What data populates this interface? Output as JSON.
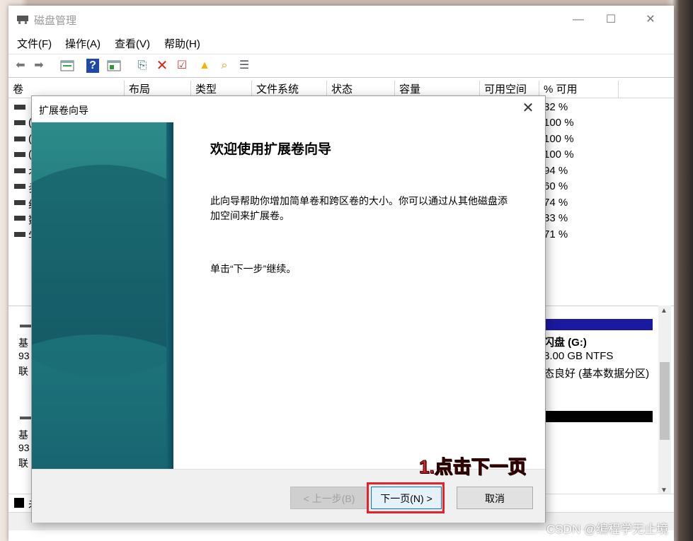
{
  "app": {
    "title": "磁盘管理"
  },
  "menu": [
    "文件(F)",
    "操作(A)",
    "查看(V)",
    "帮助(H)"
  ],
  "columns": [
    "卷",
    "布局",
    "类型",
    "文件系统",
    "状态",
    "容量",
    "可用空间",
    "% 可用"
  ],
  "rows": [
    {
      "frag": "",
      "pct": "32 %"
    },
    {
      "frag": "(",
      "pct": "100 %"
    },
    {
      "frag": "(",
      "pct": "100 %"
    },
    {
      "frag": "(",
      "pct": "100 %"
    },
    {
      "frag": "衤",
      "pct": "94 %"
    },
    {
      "frag": "夛",
      "pct": "60 %"
    },
    {
      "frag": "约",
      "pct": "74 %"
    },
    {
      "frag": "数",
      "pct": "33 %"
    },
    {
      "frag": "学",
      "pct": "71 %"
    }
  ],
  "disks": [
    {
      "line1": "基",
      "line2": "93",
      "line3": "联"
    },
    {
      "line1": "基",
      "line2": "93",
      "line3": "联"
    }
  ],
  "partition": {
    "name": "闪盘 (G:)",
    "size": "8.00 GB NTFS",
    "status": "态良好 (基本数据分区)"
  },
  "legend_frag": "未",
  "dialog": {
    "title": "扩展卷向导",
    "heading": "欢迎使用扩展卷向导",
    "desc": "此向导帮助你增加简单卷和跨区卷的大小。你可以通过从其他磁盘添加空间来扩展卷。",
    "hint": "单击“下一步”继续。",
    "back_label": "< 上一步(B)",
    "next_label": "下一页(N) >",
    "cancel_label": "取消"
  },
  "annotation": "1.点击下一页",
  "watermark": "CSDN @编程学无止境",
  "colors": {
    "accent": "#0078d7",
    "annotation": "#e8202a",
    "partition_bar": "#1a1aa0"
  }
}
